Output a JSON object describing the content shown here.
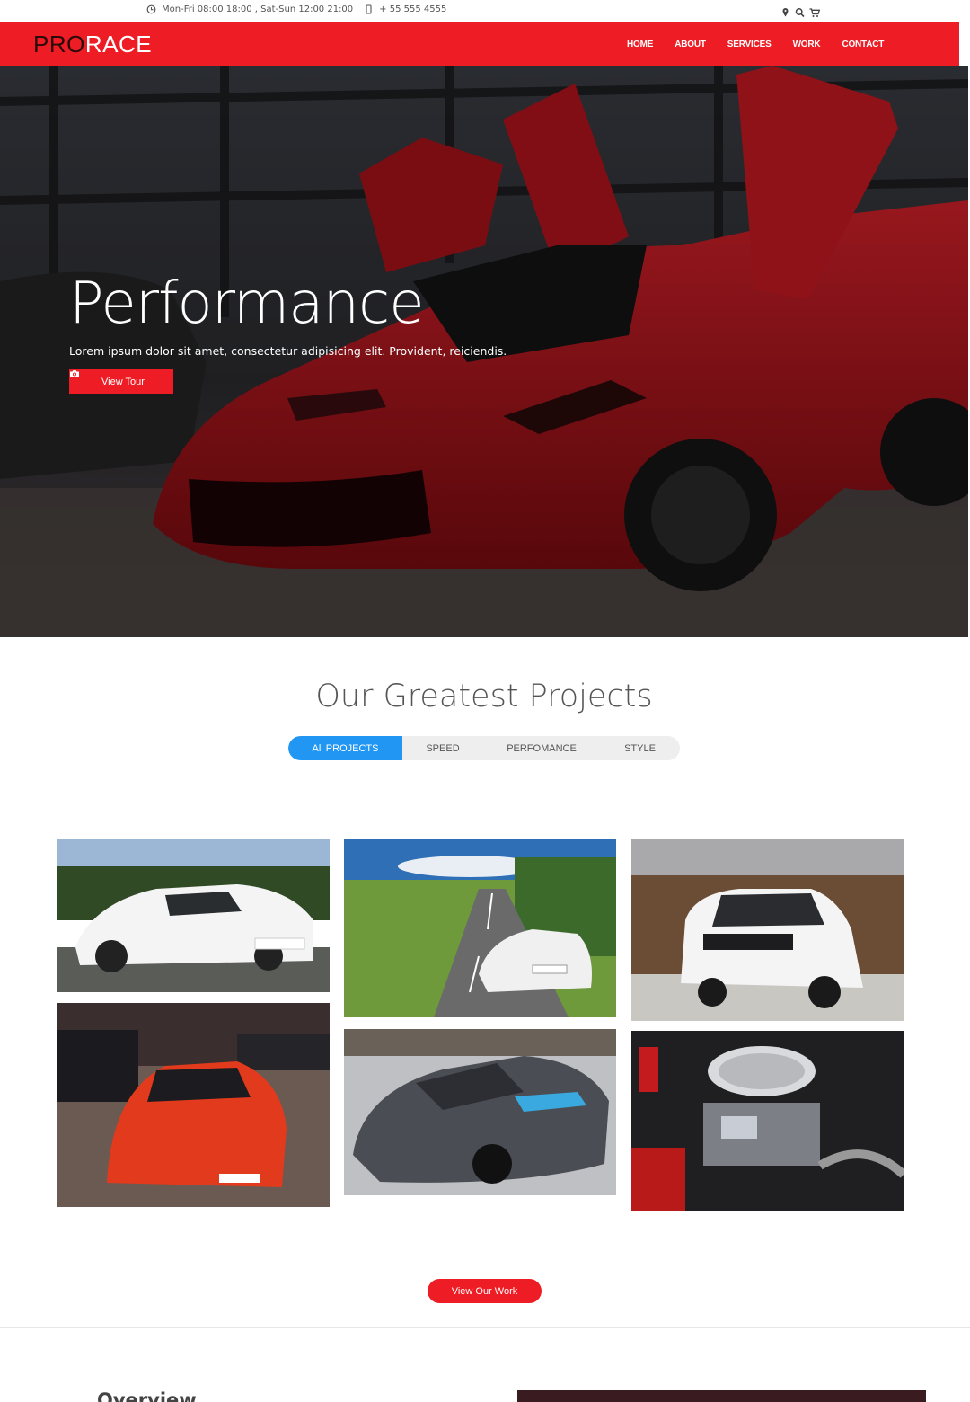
{
  "topbar": {
    "hours": "Mon-Fri 08:00 18:00 , Sat-Sun 12:00 21:00",
    "phone": "+ 55 555 4555",
    "icons": [
      "clock-icon",
      "mobile-icon",
      "map-marker-icon",
      "search-icon",
      "cart-icon"
    ]
  },
  "navbar": {
    "logo_pro": "PRO",
    "logo_race": "RACE",
    "links": [
      "HOME",
      "ABOUT",
      "SERVICES",
      "WORK",
      "CONTACT"
    ]
  },
  "hero": {
    "title": "Performance",
    "text": "Lorem ipsum dolor sit amet, consectetur adipisicing elit. Provident, reiciendis.",
    "button_label": "View Tour",
    "button_icon": "camera-icon"
  },
  "projects": {
    "title": "Our Greatest Projects",
    "filters": [
      "All PROJECTS",
      "SPEED",
      "PERFOMANCE",
      "STYLE"
    ],
    "active_filter": "All PROJECTS",
    "button_label": "View Our Work"
  },
  "overview": {
    "title": "Overview"
  },
  "colors": {
    "brand_red": "#ee1c24",
    "accent_blue": "#2196f3",
    "logo_dark": "#2b0a0a"
  }
}
